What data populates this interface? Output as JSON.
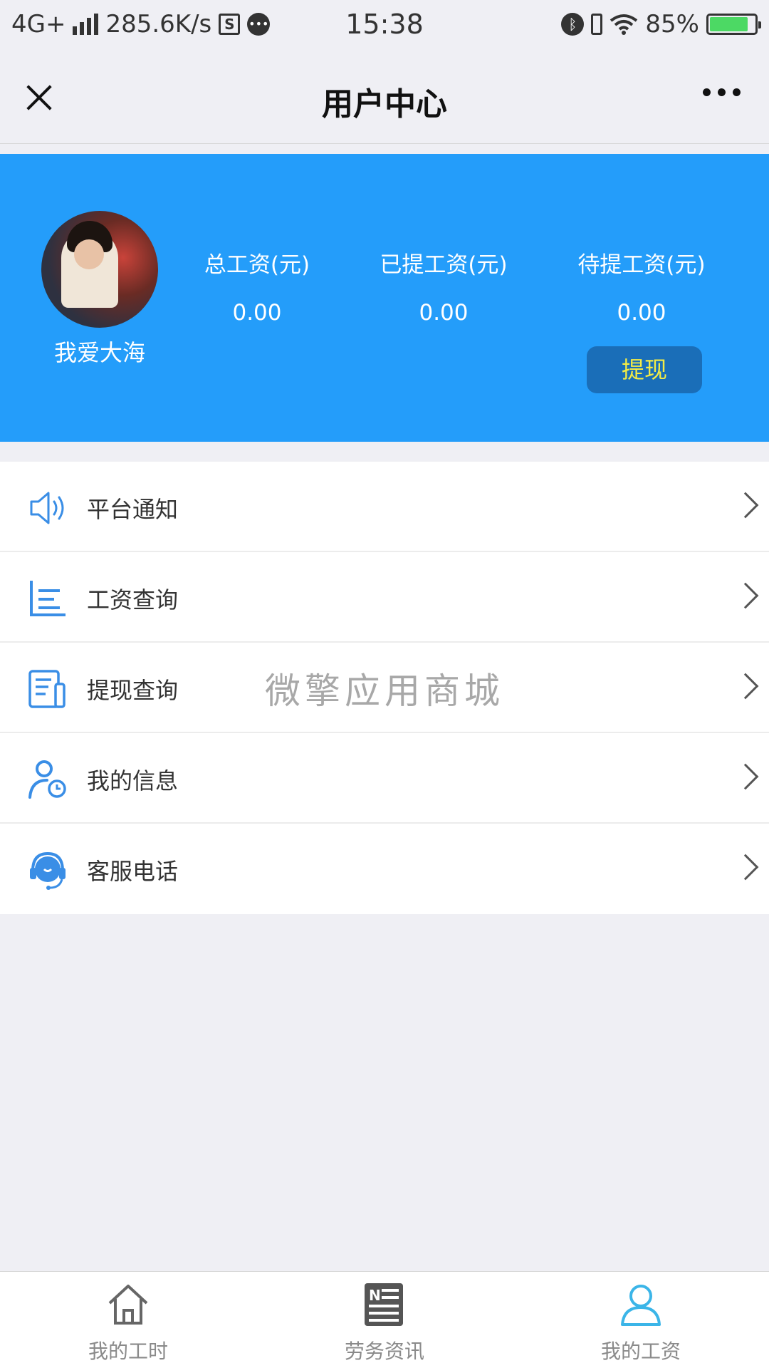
{
  "status_bar": {
    "network": "4G+",
    "speed": "285.6K/s",
    "sim_icon_label": "S",
    "time": "15:38",
    "battery": "85%",
    "battery_level": 0.85
  },
  "nav": {
    "title": "用户中心"
  },
  "profile": {
    "nickname": "我爱大海",
    "stats": [
      {
        "label": "总工资(元)",
        "value": "0.00"
      },
      {
        "label": "已提工资(元)",
        "value": "0.00"
      },
      {
        "label": "待提工资(元)",
        "value": "0.00"
      }
    ],
    "withdraw_label": "提现"
  },
  "menu": {
    "items": [
      {
        "label": "平台通知",
        "icon": "speaker-icon"
      },
      {
        "label": "工资查询",
        "icon": "bar-list-icon"
      },
      {
        "label": "提现查询",
        "icon": "document-icon"
      },
      {
        "label": "我的信息",
        "icon": "user-clock-icon"
      },
      {
        "label": "客服电话",
        "icon": "headset-icon"
      }
    ]
  },
  "watermark": "微擎应用商城",
  "tabs": [
    {
      "label": "我的工时",
      "icon": "home-icon",
      "active": false
    },
    {
      "label": "劳务资讯",
      "icon": "news-icon",
      "active": false
    },
    {
      "label": "我的工资",
      "icon": "user-icon",
      "active": true
    }
  ],
  "colors": {
    "header_blue": "#249dfa",
    "withdraw_button": "#1a6eb8",
    "withdraw_text": "#f4ec45",
    "icon_blue": "#3a8ee6",
    "tab_active": "#3bb5e8"
  }
}
